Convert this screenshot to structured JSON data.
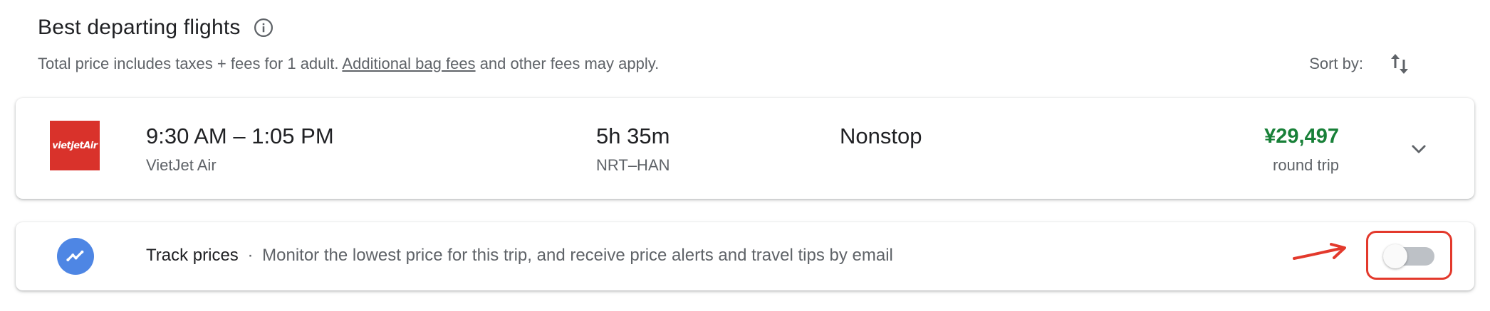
{
  "header": {
    "title": "Best departing flights",
    "info_icon": "info-icon",
    "subtitle_prefix": "Total price includes taxes + fees for 1 adult.",
    "subtitle_link": "Additional bag fees",
    "subtitle_suffix": "and other fees may apply.",
    "sort_label": "Sort by:",
    "sort_icon": "sort-arrows-icon"
  },
  "flight": {
    "airline_logo_text": "vietjetAir",
    "times": "9:30 AM – 1:05 PM",
    "airline": "VietJet Air",
    "duration": "5h 35m",
    "route": "NRT–HAN",
    "stops": "Nonstop",
    "price": "¥29,497",
    "price_note": "round trip",
    "expand_icon": "chevron-down-icon"
  },
  "track_prices": {
    "label": "Track prices",
    "separator": "·",
    "description": "Monitor the lowest price for this trip, and receive price alerts and travel tips by email",
    "icon": "trending-chart-icon",
    "toggle_on": false
  },
  "annotation": {
    "color": "#e3392c"
  },
  "colors": {
    "price_green": "#188038",
    "logo_red": "#d9322b",
    "track_icon_blue": "#4e86e4"
  }
}
